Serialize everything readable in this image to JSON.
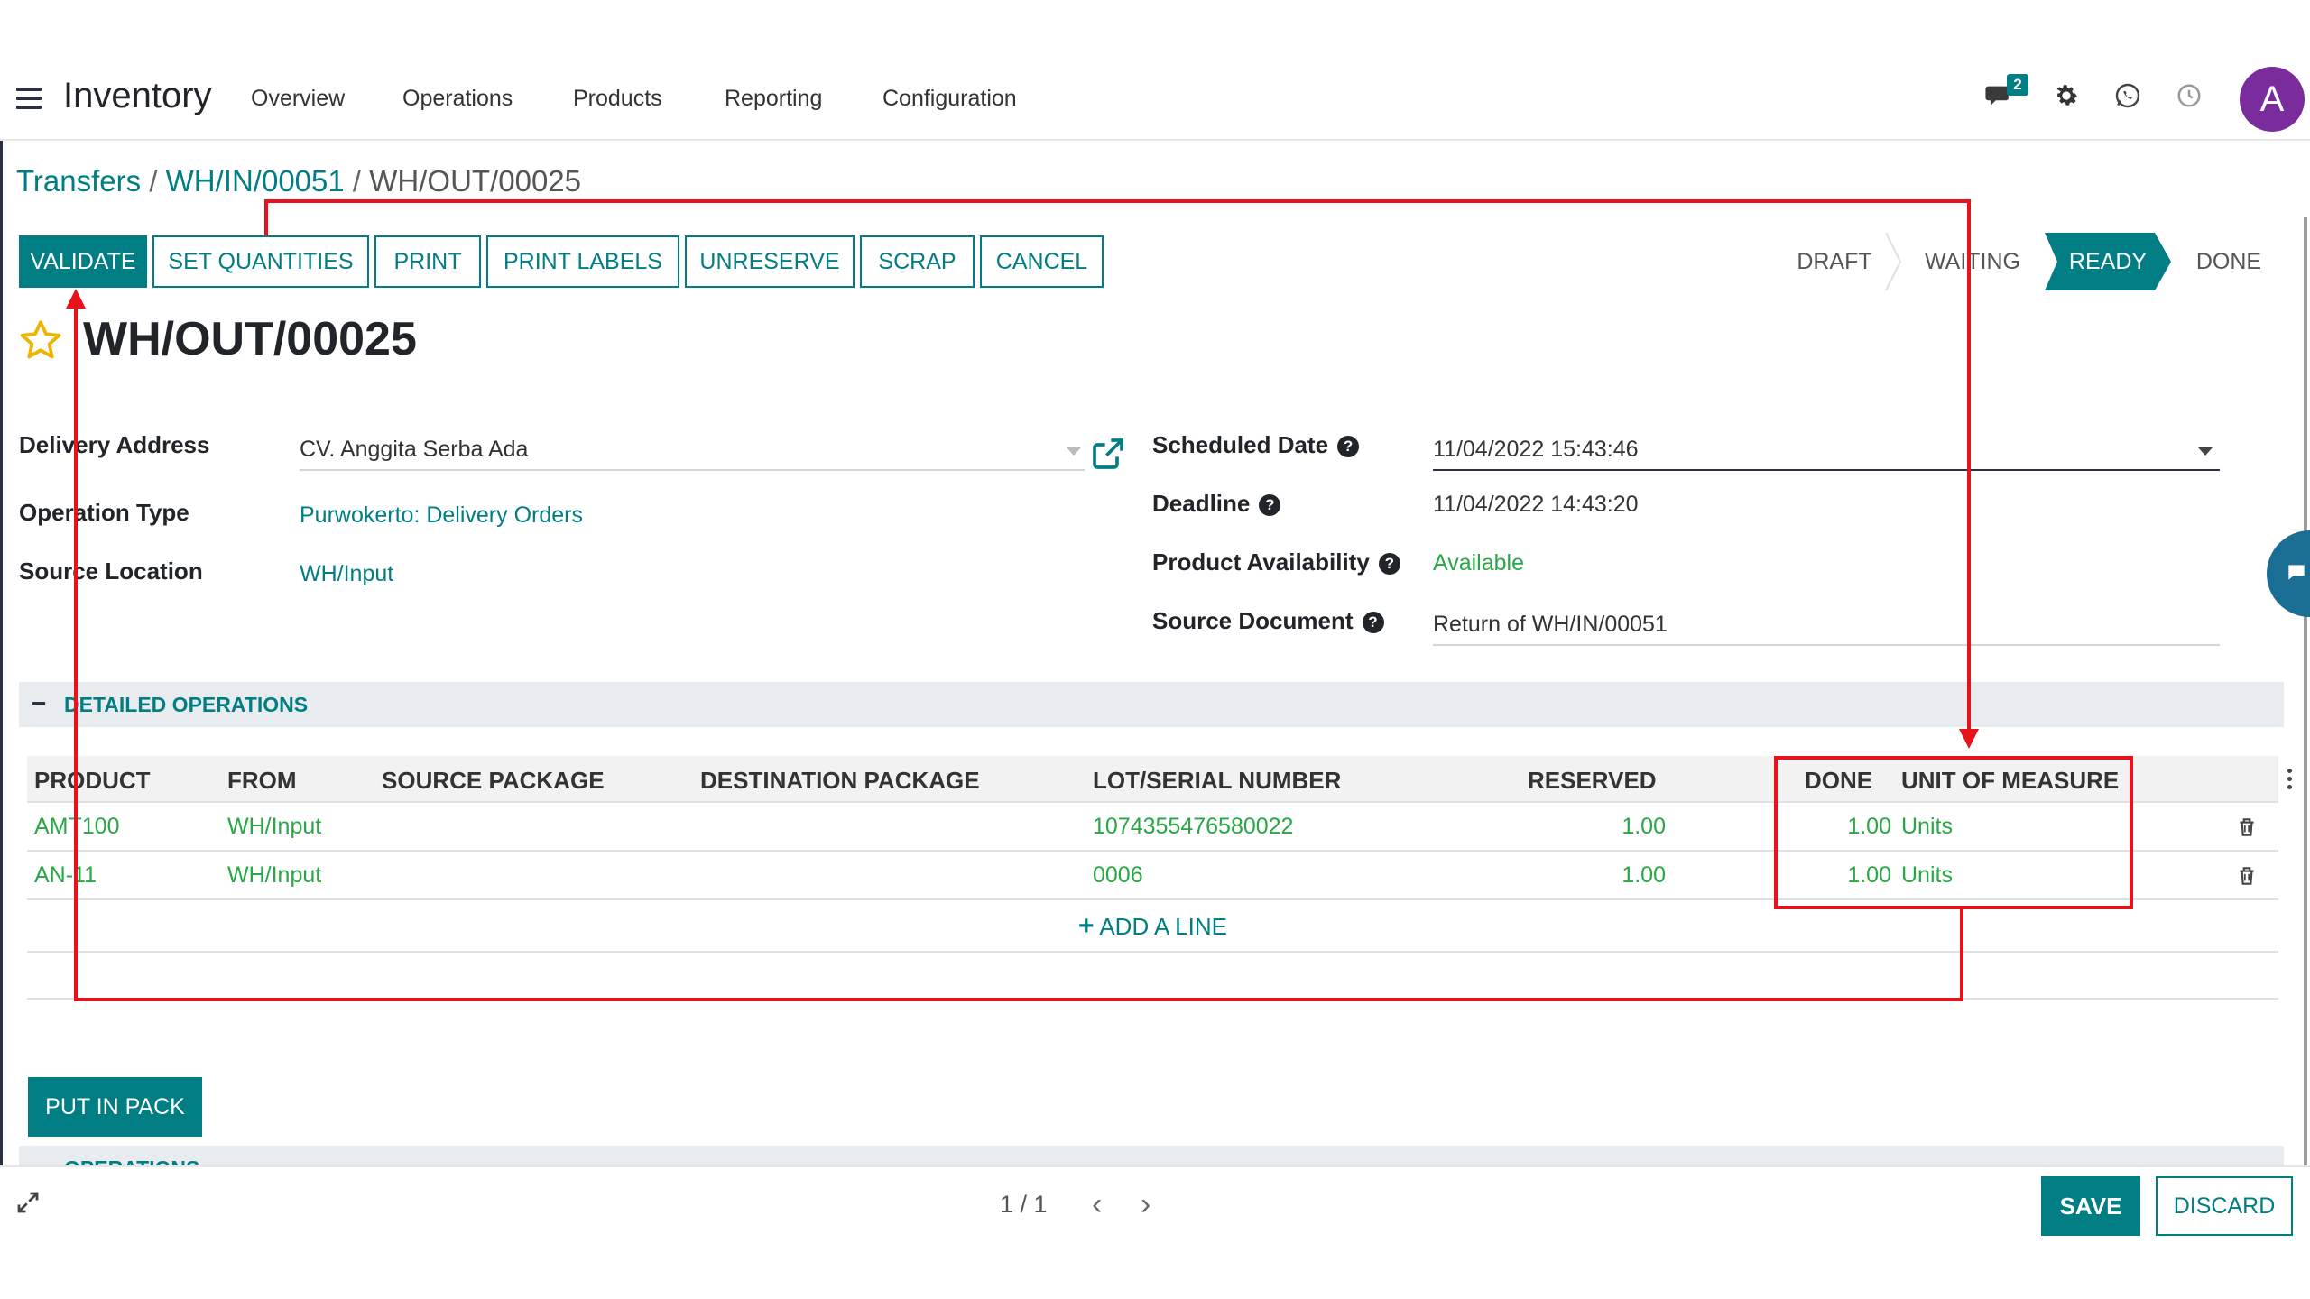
{
  "navbar": {
    "app_title": "Inventory",
    "menu": [
      "Overview",
      "Operations",
      "Products",
      "Reporting",
      "Configuration"
    ],
    "message_count": "2",
    "avatar_initial": "A"
  },
  "breadcrumb": {
    "items": [
      "Transfers",
      "WH/IN/00051"
    ],
    "separator": "/",
    "current": "WH/OUT/00025"
  },
  "actions": {
    "validate": "VALIDATE",
    "set_quantities": "SET QUANTITIES",
    "print": "PRINT",
    "print_labels": "PRINT LABELS",
    "unreserve": "UNRESERVE",
    "scrap": "SCRAP",
    "cancel": "CANCEL"
  },
  "statusbar": {
    "states": [
      "DRAFT",
      "WAITING",
      "READY",
      "DONE"
    ],
    "active": "READY"
  },
  "record": {
    "title": "WH/OUT/00025"
  },
  "form": {
    "delivery_address_label": "Delivery Address",
    "delivery_address_value": "CV. Anggita Serba Ada",
    "operation_type_label": "Operation Type",
    "operation_type_value": "Purwokerto: Delivery Orders",
    "source_location_label": "Source Location",
    "source_location_value": "WH/Input",
    "scheduled_date_label": "Scheduled Date",
    "scheduled_date_value": "11/04/2022 15:43:46",
    "deadline_label": "Deadline",
    "deadline_value": "11/04/2022 14:43:20",
    "availability_label": "Product Availability",
    "availability_value": "Available",
    "source_document_label": "Source Document",
    "source_document_value": "Return of WH/IN/00051"
  },
  "detailed_operations": {
    "title": "DETAILED OPERATIONS",
    "columns": [
      "PRODUCT",
      "FROM",
      "SOURCE PACKAGE",
      "DESTINATION PACKAGE",
      "LOT/SERIAL NUMBER",
      "RESERVED",
      "DONE",
      "UNIT OF MEASURE"
    ],
    "rows": [
      {
        "product": "AMT100",
        "from": "WH/Input",
        "source_package": "",
        "destination_package": "",
        "lot": "1074355476580022",
        "reserved": "1.00",
        "done": "1.00",
        "uom": "Units"
      },
      {
        "product": "AN-11",
        "from": "WH/Input",
        "source_package": "",
        "destination_package": "",
        "lot": "0006",
        "reserved": "1.00",
        "done": "1.00",
        "uom": "Units"
      }
    ],
    "add_line": "ADD A LINE"
  },
  "put_in_pack": "PUT IN PACK",
  "next_section": "OPERATIONS",
  "footer": {
    "pager": "1 / 1",
    "save": "SAVE",
    "discard": "DISCARD"
  },
  "colors": {
    "accent": "#017e84",
    "annotation": "#e8121d",
    "avatar": "#7b2c9c",
    "available": "#28a745"
  }
}
